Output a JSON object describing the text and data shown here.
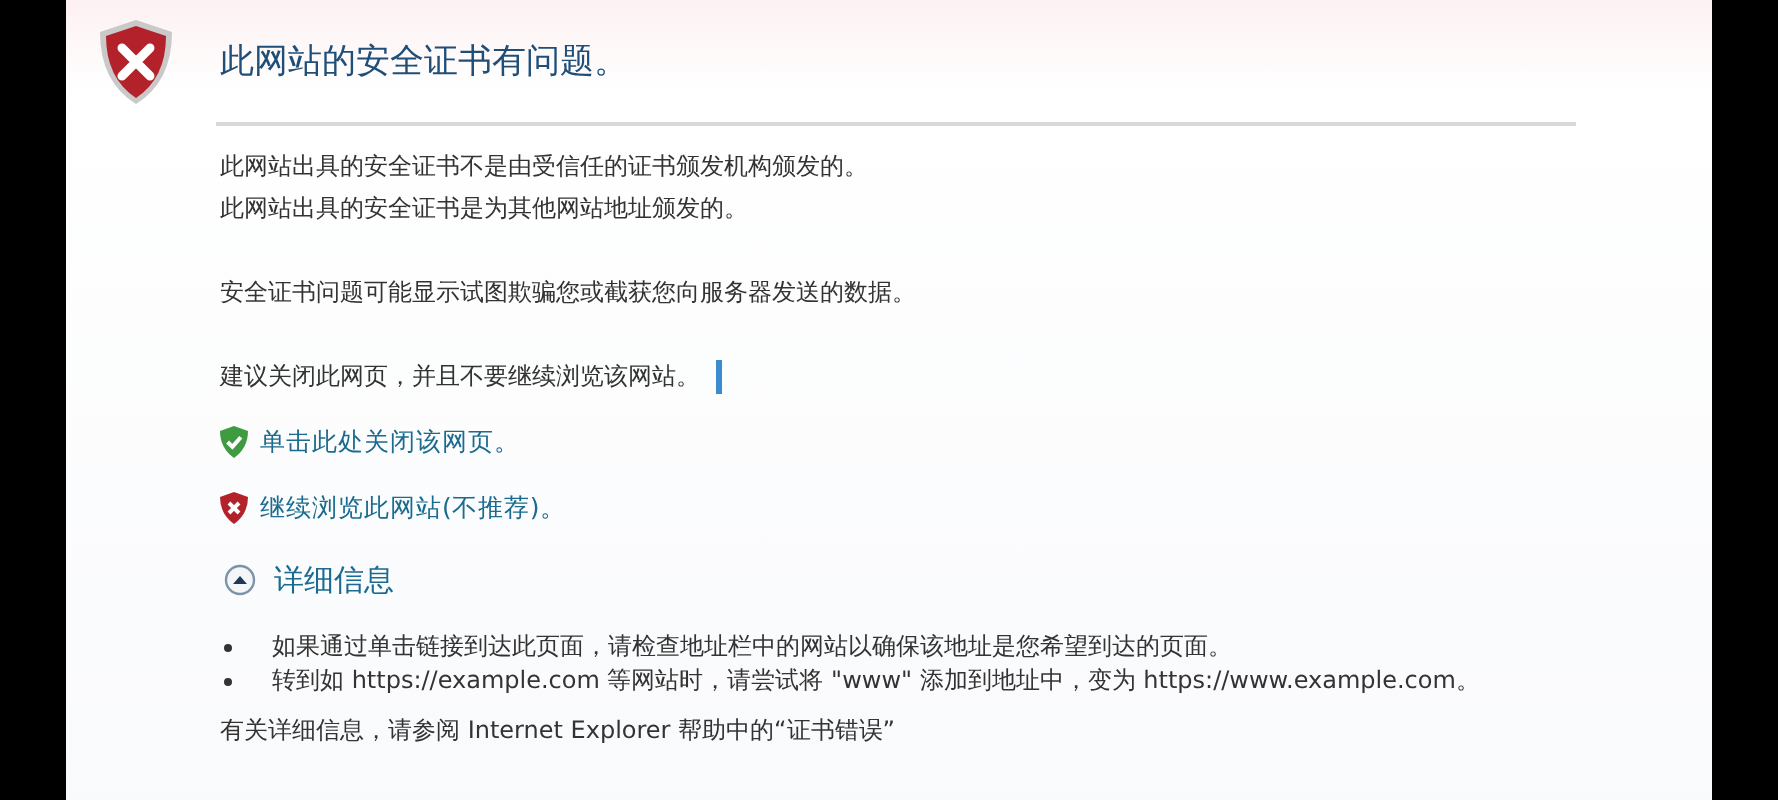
{
  "title": "此网站的安全证书有问题。",
  "problems": [
    "此网站出具的安全证书不是由受信任的证书颁发机构颁发的。",
    "此网站出具的安全证书是为其他网站地址颁发的。"
  ],
  "warning": "安全证书问题可能显示试图欺骗您或截获您向服务器发送的数据。",
  "recommendation": "建议关闭此网页，并且不要继续浏览该网站。",
  "actions": [
    {
      "kind": "safe",
      "label": "单击此处关闭该网页。"
    },
    {
      "kind": "unsafe",
      "label": "继续浏览此网站(不推荐)。"
    }
  ],
  "details": {
    "label": "详细信息",
    "expanded": true,
    "bullets": [
      "如果通过单击链接到达此页面，请检查地址栏中的网站以确保该地址是您希望到达的页面。",
      "转到如 https://example.com 等网站时，请尝试将 \"www\" 添加到地址中，变为 https://www.example.com。"
    ],
    "more": "有关详细信息，请参阅 Internet Explorer 帮助中的“证书错误”"
  }
}
